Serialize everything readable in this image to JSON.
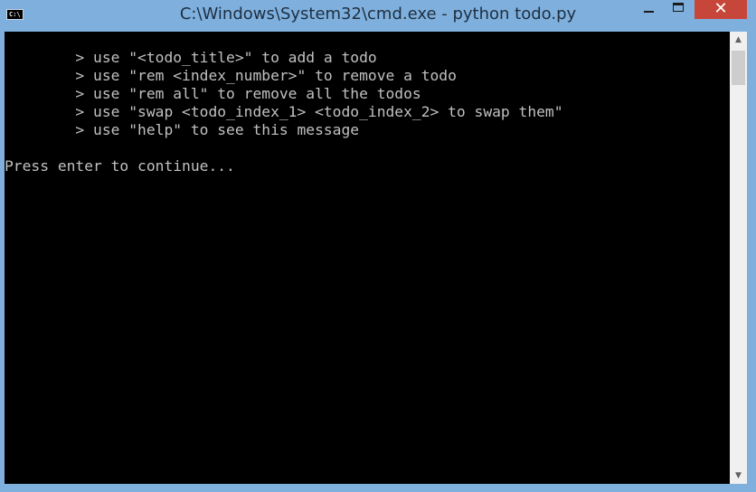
{
  "window": {
    "title": "C:\\Windows\\System32\\cmd.exe - python  todo.py",
    "icon_label": "C:\\",
    "minimize": "minimize-icon",
    "maximize": "maximize-icon",
    "close_label": "✕"
  },
  "console": {
    "lines": [
      "        > use \"<todo_title>\" to add a todo",
      "        > use \"rem <index_number>\" to remove a todo",
      "        > use \"rem all\" to remove all the todos",
      "        > use \"swap <todo_index_1> <todo_index_2> to swap them\"",
      "        > use \"help\" to see this message",
      "",
      "Press enter to continue..."
    ]
  },
  "scrollbar": {
    "up_icon": "▲",
    "down_icon": "▼"
  },
  "colors": {
    "titlebar": "#7fb0dd",
    "console_bg": "#000000",
    "console_text": "#c0c0c0",
    "close_button": "#c7463a"
  }
}
